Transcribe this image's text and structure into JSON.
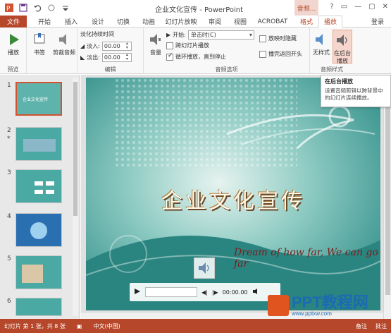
{
  "window": {
    "title": "企业文化宣传 - PowerPoint",
    "context_tab": "音频...",
    "controls": [
      "?",
      "▭",
      "—",
      "▢",
      "✕"
    ]
  },
  "tabs": [
    "文件",
    "开始",
    "插入",
    "设计",
    "切换",
    "动画",
    "幻灯片放映",
    "审阅",
    "视图",
    "ACROBAT",
    "格式",
    "播放",
    "登录"
  ],
  "active_tab": "播放",
  "ribbon": {
    "preview_group": {
      "label": "预览",
      "play": "播放"
    },
    "bookmark_group": {
      "bookmarks": "书签",
      "trim": "剪裁音频"
    },
    "edit_group": {
      "label": "编辑",
      "fade_title": "淡化持续时间",
      "fade_in_label": "淡入:",
      "fade_in_value": "00.00",
      "fade_out_label": "淡出:",
      "fade_out_value": "00.00"
    },
    "audio_options": {
      "label": "音频选项",
      "volume": "音量",
      "start_label": "开始:",
      "start_value": "单击时(C)",
      "cross_slides": "跨幻灯片播放",
      "loop": "循环播放，直到停止",
      "hide_during_show": "放映时隐藏",
      "rewind": "播完返回开头"
    },
    "audio_styles": {
      "label": "音频样式",
      "no_style": "无样式",
      "play_bg": "在后台播放"
    }
  },
  "tooltip": {
    "title": "在后台播放",
    "description": "设置音频剪辑以跨背景中的幻灯片连续播放。"
  },
  "thumbnails": [
    {
      "num": "1",
      "marker": "",
      "caption": "企业文化宣传"
    },
    {
      "num": "2",
      "marker": "*",
      "caption": ""
    },
    {
      "num": "3",
      "marker": "",
      "caption": ""
    },
    {
      "num": "4",
      "marker": "",
      "caption": ""
    },
    {
      "num": "5",
      "marker": "",
      "caption": ""
    },
    {
      "num": "6",
      "marker": "",
      "caption": ""
    }
  ],
  "slide": {
    "title": "企业文化宣传",
    "subtitle": "Dream of how far, We can go far"
  },
  "player": {
    "time": "00:00.00"
  },
  "status": {
    "slide_info": "幻灯片 第 1 张，共 8 张",
    "language": "中文(中国)",
    "notes": "备注",
    "comments": "批注"
  },
  "watermark": {
    "brand": "PPT教程网",
    "url": "www.pptxw.com"
  },
  "colors": {
    "accent": "#b7472a",
    "slide_bg": "#3b9a96"
  }
}
